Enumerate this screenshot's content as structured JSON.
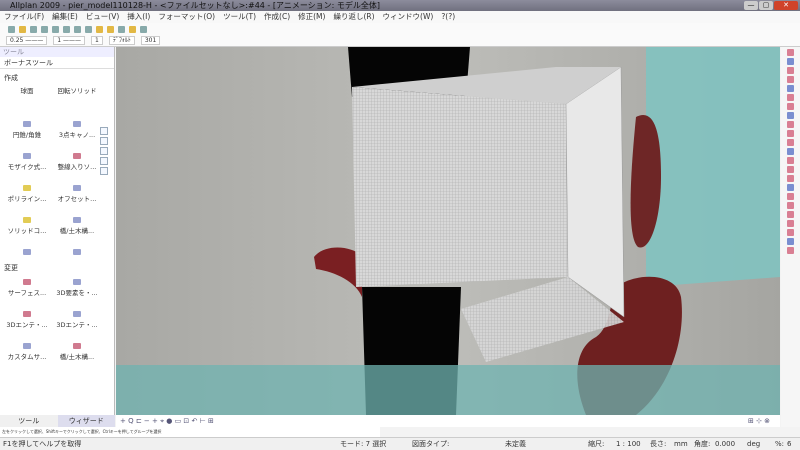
{
  "window": {
    "title": "Allplan 2009 - pier_model110128-H - <ファイルセットなし>:#44 - [アニメーション: モデル全体]",
    "min": "—",
    "max": "▢",
    "close": "✕"
  },
  "menu": [
    "ファイル(F)",
    "編集(E)",
    "ビュー(V)",
    "挿入(I)",
    "フォーマット(O)",
    "ツール(T)",
    "作成(C)",
    "修正(M)",
    "繰り返し(R)",
    "ウィンドウ(W)",
    "?(?)"
  ],
  "format_bar": {
    "pen": "0.25 ———",
    "line": "1 ———",
    "color": "1",
    "layer": "ﾃﾞﾌｫﾙﾄ",
    "pattern": "301"
  },
  "panel": {
    "header": "ツール",
    "module": "ボーナスツール",
    "section_create": "作成",
    "create_items": [
      "球面",
      "回転ソリッド",
      "円錐/角錐",
      "3点キャノ...",
      "モザイク式...",
      "整線入りソ...",
      "ポリライン...",
      "オフセット...",
      "ソリッドコ...",
      "橋/土木構...",
      "",
      ""
    ],
    "section_modify": "変更",
    "modify_items": [
      "サーフェス...",
      "3D要素を・...",
      "3Dエンテ・...",
      "3Dエンテ・...",
      "カスタムサ...",
      "橋/土木構..."
    ],
    "tabs": [
      "ツール",
      "ウィザード"
    ],
    "hint": "左をクリックして選択、Shiftキーでクリックして選択、Ctrlキーを押してグループを選択"
  },
  "viewport_bar": {
    "tools": "+ Q ⊏ − + ⌖ ● ▭ ⊡ ↶ ⊢ ⊞",
    "right": "⊞ ⊹ ⊗"
  },
  "status": {
    "help": "F1を押してヘルプを取得",
    "mode": "モード: 7 選択",
    "drawing_type_label": "図面タイプ:",
    "drawing_type": "未定義",
    "scale_label": "縮尺:",
    "scale": "1 : 100",
    "length_label": "長さ:",
    "length_unit": "mm",
    "angle_label": "角度:",
    "angle": "0.000",
    "angle_unit": "deg",
    "percent_label": "%:",
    "percent": "6"
  }
}
